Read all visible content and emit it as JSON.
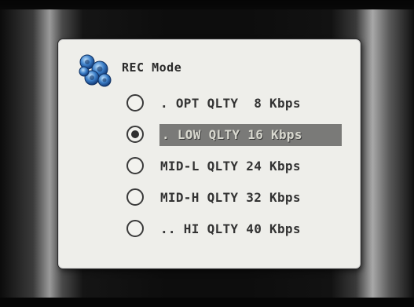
{
  "dialog": {
    "title": "REC Mode",
    "logo_icon": "blue-gear-cluster-icon",
    "selected_index": 1,
    "options": [
      {
        "label": ". OPT QLTY  8 Kbps",
        "selected": false
      },
      {
        "label": ". LOW QLTY 16 Kbps",
        "selected": true
      },
      {
        "label": "MID-L QLTY 24 Kbps",
        "selected": false
      },
      {
        "label": "MID-H QLTY 32 Kbps",
        "selected": false
      },
      {
        "label": ".. HI QLTY 40 Kbps",
        "selected": false
      }
    ]
  },
  "colors": {
    "dialog_bg": "#eeeeea",
    "highlight_bg": "#7a7a78",
    "logo_blue": "#3c7fc8"
  }
}
